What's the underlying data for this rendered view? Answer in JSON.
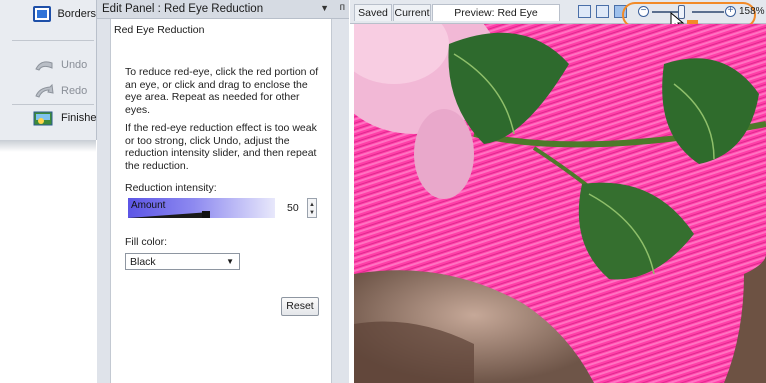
{
  "left_toolbar": {
    "items": [
      {
        "label": "Borders",
        "icon": "borders-icon"
      },
      {
        "label": "Undo",
        "icon": "undo-icon"
      },
      {
        "label": "Redo",
        "icon": "redo-icon"
      },
      {
        "label": "Finished",
        "icon": "finished-icon"
      }
    ]
  },
  "panel": {
    "header_title": "Edit Panel : Red Eye Reduction",
    "section_title": "Red Eye Reduction",
    "instructions": "To reduce red-eye, click the red portion of an eye, or click and drag to enclose the eye area. Repeat as needed for other eyes.",
    "help": "If the red-eye reduction effect is too weak or too strong, click Undo, adjust the reduction intensity slider, and then repeat the reduction.",
    "intensity_label": "Reduction intensity:",
    "amount_label": "Amount",
    "amount_value": "50",
    "fill_color_label": "Fill color:",
    "fill_color_value": "Black",
    "reset_label": "Reset"
  },
  "preview": {
    "tabs": [
      "Saved",
      "Current",
      "Preview: Red Eye Reduction"
    ],
    "active_tab": 2,
    "zoom_value": "158%"
  },
  "colors": {
    "accent_highlight": "#f28a28",
    "slider_fill": "#5c55e6",
    "hat_pink": "#ff3fa8"
  }
}
